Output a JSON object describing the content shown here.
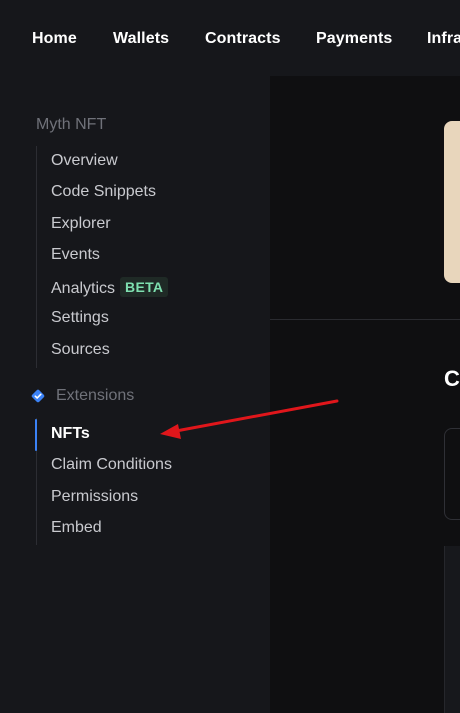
{
  "topnav": {
    "items": [
      "Home",
      "Wallets",
      "Contracts",
      "Payments",
      "Infra"
    ]
  },
  "sidebar": {
    "section_title": "Myth NFT",
    "items": [
      {
        "label": "Overview"
      },
      {
        "label": "Code Snippets"
      },
      {
        "label": "Explorer"
      },
      {
        "label": "Events"
      },
      {
        "label": "Analytics",
        "badge": "BETA"
      },
      {
        "label": "Settings"
      },
      {
        "label": "Sources"
      }
    ],
    "extensions_title": "Extensions",
    "extension_items": [
      {
        "label": "NFTs",
        "active": true
      },
      {
        "label": "Claim Conditions"
      },
      {
        "label": "Permissions"
      },
      {
        "label": "Embed"
      }
    ]
  },
  "main": {
    "heading_fragment": "C"
  },
  "colors": {
    "background": "#16171b",
    "main_panel": "#0f0f11",
    "accent_blue": "#3b82f6",
    "warning_card": "#e8d6bc",
    "badge_text": "#7ee0b0",
    "annotation_arrow": "#e0161b"
  }
}
